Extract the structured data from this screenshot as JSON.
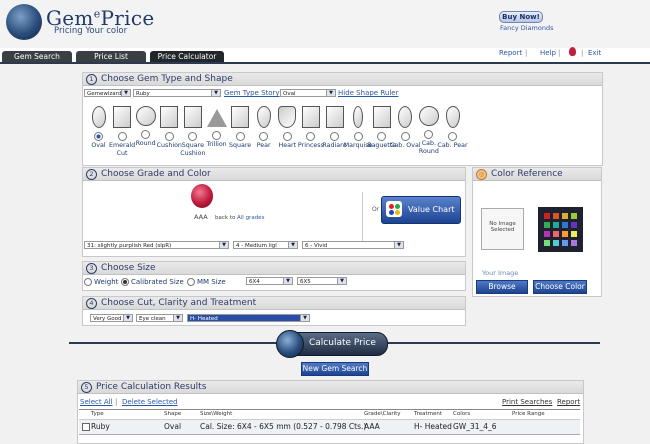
{
  "header": {
    "logo_main": "Gem",
    "logo_sup": "e",
    "logo_end": "Price",
    "tagline": "Pricing Your color",
    "buy_now": "Buy Now!",
    "fancy_diamonds": "Fancy Diamonds"
  },
  "tabs": [
    {
      "label": "Gem Search"
    },
    {
      "label": "Price List"
    },
    {
      "label": "Price Calculator"
    }
  ],
  "top_links": {
    "report": "Report",
    "help": "Help",
    "exit": "Exit",
    "sep": "|"
  },
  "section1": {
    "number": "1",
    "title": "Choose Gem Type and Shape",
    "category": "Gemewizard",
    "gem": "Ruby",
    "gem_type_story": "Gem Type Story",
    "shape": "Oval",
    "hide_shape_ruler": "Hide Shape Ruler",
    "shapes": [
      {
        "label": "Oval",
        "icon": "oval-shape-icon",
        "selected": true
      },
      {
        "label": "Emerald Cut",
        "icon": "emerald-cut-shape-icon"
      },
      {
        "label": "Round",
        "icon": "round-shape-icon"
      },
      {
        "label": "Cushion",
        "icon": "cushion-shape-icon"
      },
      {
        "label": "Square Cushion",
        "icon": "square-cushion-shape-icon"
      },
      {
        "label": "Trillion",
        "icon": "trillion-shape-icon"
      },
      {
        "label": "Square",
        "icon": "square-shape-icon"
      },
      {
        "label": "Pear",
        "icon": "pear-shape-icon"
      },
      {
        "label": "Heart",
        "icon": "heart-shape-icon"
      },
      {
        "label": "Princess",
        "icon": "princess-shape-icon"
      },
      {
        "label": "Radiant",
        "icon": "radiant-shape-icon"
      },
      {
        "label": "Marquise",
        "icon": "marquise-shape-icon"
      },
      {
        "label": "Baguette",
        "icon": "baguette-shape-icon"
      },
      {
        "label": "Cab. Oval",
        "icon": "cab-oval-shape-icon"
      },
      {
        "label": "Cab. Round",
        "icon": "cab-round-shape-icon"
      },
      {
        "label": "Cab. Pear",
        "icon": "cab-pear-shape-icon"
      }
    ]
  },
  "section2": {
    "number": "2",
    "title": "Choose Grade and Color",
    "grade": "AAA",
    "back_to": "back to",
    "all_grades": "All grades",
    "or": "Or",
    "value_chart": "Value Chart",
    "hue": "31: slightly purplish Red (slpR)",
    "tone": "4 - Medium ligl",
    "saturation": "6 - Vivid"
  },
  "color_reference": {
    "title": "Color Reference",
    "no_image": "No Image Selected",
    "your_image": "Your Image",
    "browse": "Browse",
    "choose_color": "Choose Color"
  },
  "section3": {
    "number": "3",
    "title": "Choose Size",
    "weight": "Weight",
    "calibrated": "Calibrated Size",
    "mm": "MM Size",
    "size_a": "6X4",
    "size_b": "6X5"
  },
  "section4": {
    "number": "4",
    "title": "Choose Cut, Clarity and Treatment",
    "cut": "Very Good",
    "clarity": "Eye clean",
    "treatment": "H- Heated"
  },
  "calculate_label": "Calculate Price",
  "new_search_label": "New Gem Search",
  "section5": {
    "number": "5",
    "title": "Price Calculation Results",
    "select_all": "Select All",
    "delete_selected": "Delete Selected",
    "print_searches": "Print Searches",
    "report": "Report",
    "columns": [
      "Type",
      "Shape",
      "Size\\Weight",
      "Grade\\Clarity",
      "Treatment",
      "Colors",
      "Price Range"
    ],
    "rows": [
      {
        "type": "Ruby",
        "shape": "Oval",
        "size": "Cal. Size: 6X4 - 6X5 mm (0.527 - 0.798 Cts.)",
        "grade": "AAA",
        "treatment": "H- Heated",
        "colors": "GW_31_4_6",
        "price": ""
      }
    ]
  },
  "colors": {
    "accent": "#2a4ea8",
    "title_text": "#2b3c66",
    "tab_dark": "#3b3f45",
    "gem_red": "#c0183a"
  }
}
